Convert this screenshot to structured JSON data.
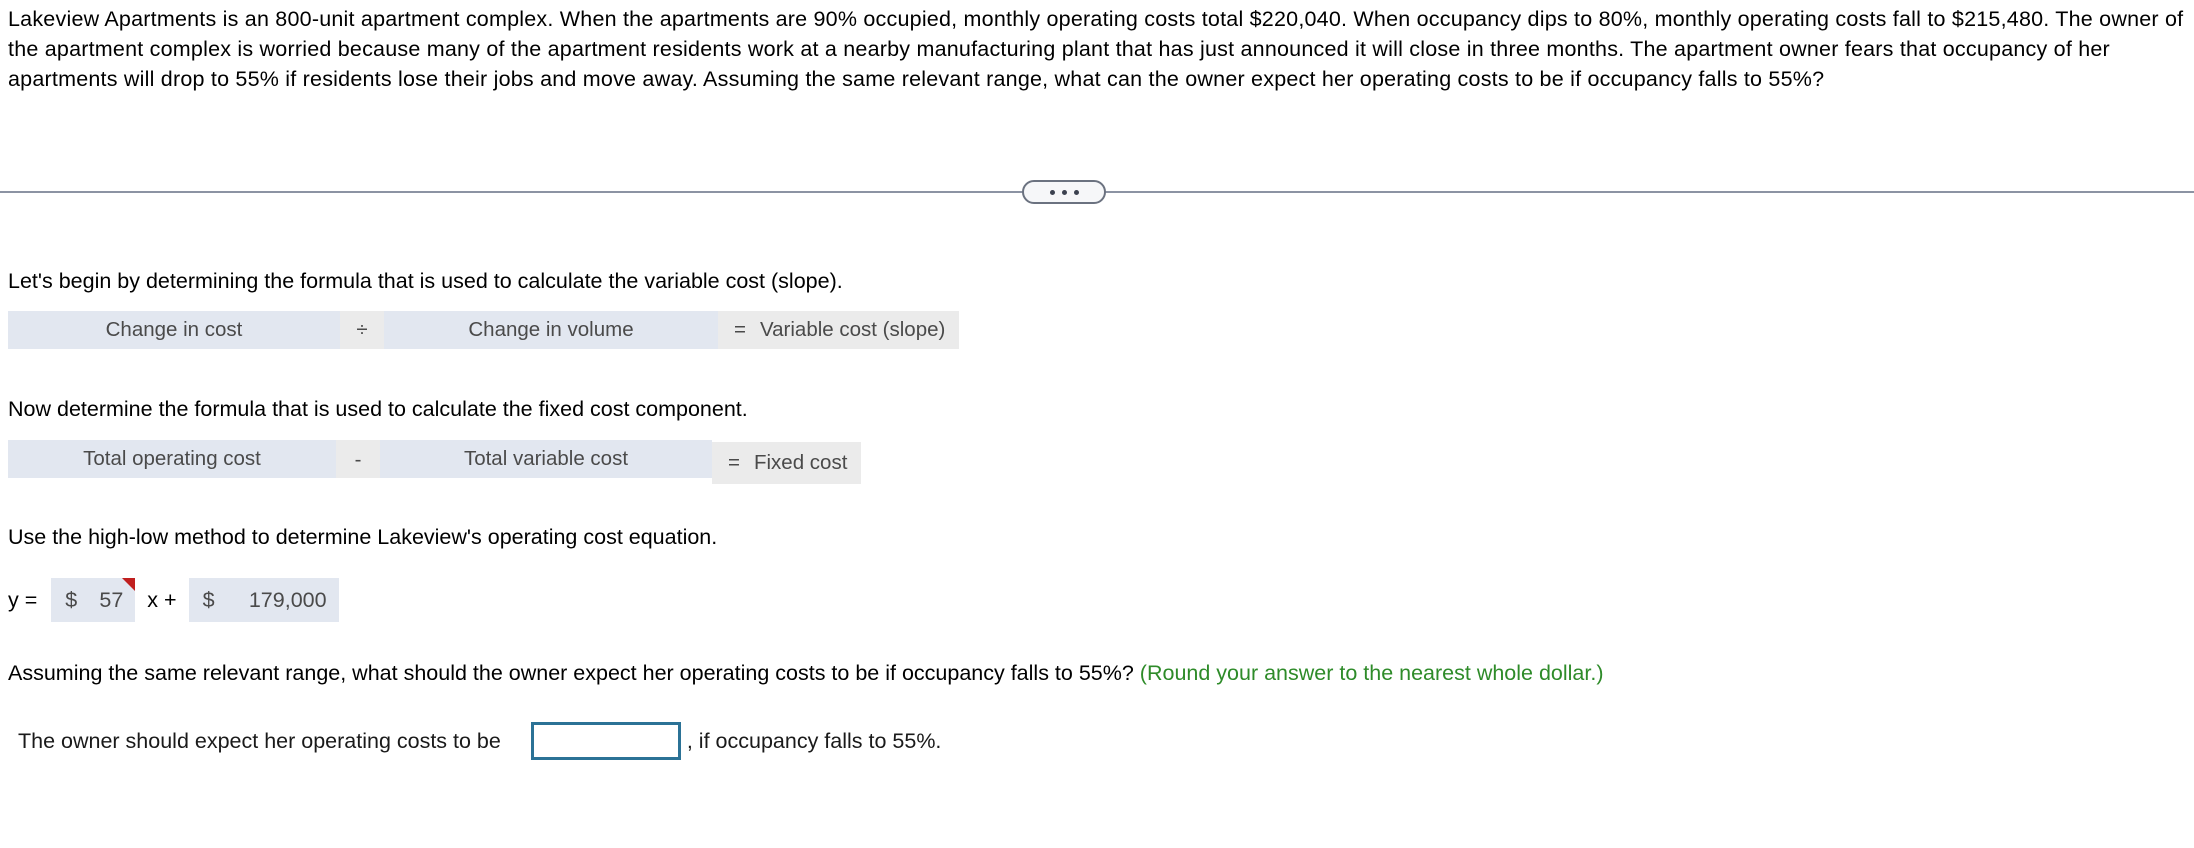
{
  "problem": {
    "statement": "Lakeview Apartments is an 800-unit apartment complex. When the apartments are 90% occupied, monthly operating costs total $220,040. When occupancy dips to 80%, monthly operating costs fall to $215,480. The owner of the apartment complex is worried because many of the apartment residents work at a nearby manufacturing plant that has just announced it will close in three months. The apartment owner fears that occupancy of her apartments will drop to 55% if residents lose their jobs and move away. Assuming the same relevant range, what can the owner expect her operating costs to be if occupancy falls to 55%?"
  },
  "divider": {
    "expand_button_label": "•••"
  },
  "steps": {
    "step1_prompt": "Let's begin by determining the formula that is used to calculate the variable cost (slope).",
    "step2_prompt": "Now determine the formula that is used to calculate the fixed cost component.",
    "step3_prompt": "Use the high-low method to determine Lakeview's operating cost equation."
  },
  "formula1": {
    "term1": "Change in cost",
    "operator": "÷",
    "term2": "Change in volume",
    "equals": "=",
    "result": "Variable cost (slope)"
  },
  "formula2": {
    "term1": "Total operating cost",
    "operator": "-",
    "term2": "Total variable cost",
    "equals": "=",
    "result": "Fixed cost"
  },
  "equation": {
    "lead": "y =",
    "slope_currency": "$",
    "slope_value": "57",
    "mid": "x +",
    "intercept_currency": "$",
    "intercept_value": "179,000"
  },
  "question": {
    "text": "Assuming the same relevant range, what should the owner expect her operating costs to be if occupancy falls to 55%?",
    "hint": "(Round your answer to the nearest whole dollar.)",
    "hint_color": "#2e8b29"
  },
  "final_answer": {
    "lead": "The owner should expect her operating costs to be",
    "input_value": "",
    "input_placeholder": "",
    "tail": ", if occupancy falls to 55%."
  },
  "colors": {
    "select_cell": "#e2e7f0",
    "operator_cell": "#ebebeb",
    "divider_rule": "#8c93a3",
    "input_border": "#2b7296",
    "flag_marker": "#c01f1f"
  }
}
